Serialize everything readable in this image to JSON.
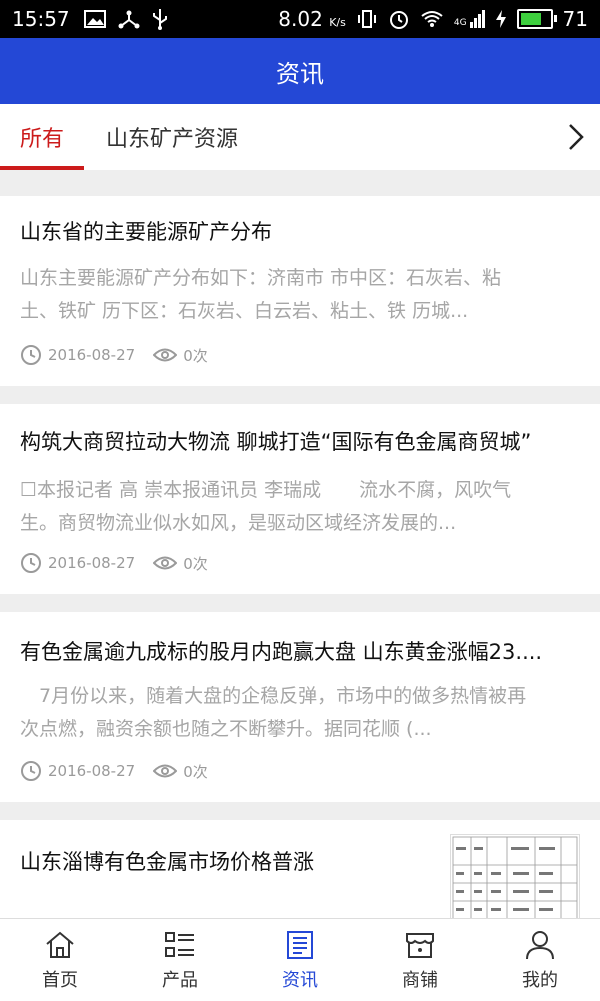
{
  "status_bar": {
    "time": "15:57",
    "net_speed": "8.02",
    "net_unit": "K/s",
    "signal_label": "4G",
    "battery": "71",
    "battery_level": 0.71
  },
  "header": {
    "title": "资讯"
  },
  "tabs": [
    {
      "label": "所有",
      "active": true
    },
    {
      "label": "山东矿产资源",
      "active": false
    }
  ],
  "articles": [
    {
      "title": "山东省的主要能源矿产分布",
      "summary_line1": "山东主要能源矿产分布如下：济南市 市中区：石灰岩、粘",
      "summary_line2": "土、铁矿 历下区：石灰岩、白云岩、粘土、铁 历城...",
      "date": "2016-08-27",
      "views": "0次"
    },
    {
      "title": "构筑大商贸拉动大物流 聊城打造“国际有色金属商贸城”",
      "summary_line1": "☐本报记者 高 崇本报通讯员 李瑞成　　流水不腐，风吹气",
      "summary_line2": "生。商贸物流业似水如风，是驱动区域经济发展的...",
      "date": "2016-08-27",
      "views": "0次"
    },
    {
      "title": "有色金属逾九成标的股月内跑赢大盘 山东黄金涨幅23....",
      "summary_line1": "　7月份以来，随着大盘的企稳反弹，市场中的做多热情被再",
      "summary_line2": "次点燃，融资余额也随之不断攀升。据同花顺 (...",
      "date": "2016-08-27",
      "views": "0次"
    },
    {
      "title": "山东淄博有色金属市场价格普涨"
    }
  ],
  "bottom_nav": [
    {
      "label": "首页",
      "icon": "home-icon"
    },
    {
      "label": "产品",
      "icon": "product-list-icon"
    },
    {
      "label": "资讯",
      "icon": "news-icon",
      "active": true
    },
    {
      "label": "商铺",
      "icon": "store-icon"
    },
    {
      "label": "我的",
      "icon": "user-icon"
    }
  ],
  "colors": {
    "header": "#2448d6",
    "accent_red": "#cc1b1b",
    "nav_active": "#2448d6"
  }
}
